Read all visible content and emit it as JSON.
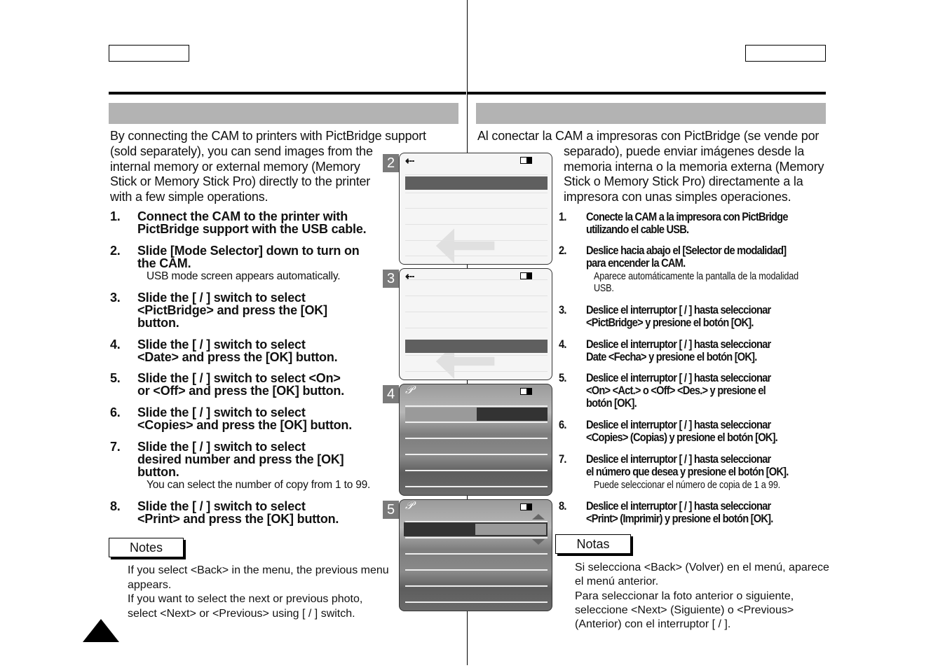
{
  "page": {
    "left_header_box": "",
    "right_header_box": ""
  },
  "en": {
    "intro": [
      "By connecting the CAM to printers with PictBridge support",
      "(sold separately), you can send images from the",
      "internal memory or external memory (Memory",
      "Stick or Memory Stick Pro) directly to the printer",
      "with a few simple operations."
    ],
    "steps": [
      {
        "num": "1.",
        "lines": [
          "Connect the CAM to the printer with",
          "PictBridge support with the USB cable."
        ]
      },
      {
        "num": "2.",
        "lines": [
          "Slide [Mode Selector] down to turn on",
          "the CAM."
        ],
        "note": [
          "USB mode screen appears automatically."
        ]
      },
      {
        "num": "3.",
        "lines": [
          "Slide the [     /     ] switch to select",
          "<PictBridge> and press the [OK]",
          "button."
        ]
      },
      {
        "num": "4.",
        "lines": [
          "Slide the [     /     ] switch to select",
          "<Date> and press the [OK] button."
        ]
      },
      {
        "num": "5.",
        "lines": [
          "Slide the [     /     ] switch to select <On>",
          "or <Off> and press the [OK] button."
        ]
      },
      {
        "num": "6.",
        "lines": [
          "Slide the [     /     ] switch to select",
          "<Copies> and press the [OK] button."
        ]
      },
      {
        "num": "7.",
        "lines": [
          "Slide the [     /     ] switch to select",
          "desired number and press the [OK]",
          "button."
        ],
        "note": [
          "You can select the number of copy from 1 to 99."
        ]
      },
      {
        "num": "8.",
        "lines": [
          "Slide the [     /     ] switch to select",
          "<Print> and press the [OK] button."
        ]
      }
    ],
    "notes_label": "Notes",
    "notes": [
      "If you select <Back> in the menu, the previous menu",
      "appears.",
      "If you want to select the next or previous photo,",
      "select <Next> or <Previous> using [     /     ] switch."
    ]
  },
  "es": {
    "intro": [
      "Al conectar la CAM a impresoras con PictBridge (se vende por",
      "separado), puede enviar imágenes desde la",
      "memoria interna o la memoria externa (Memory",
      "Stick o Memory Stick Pro) directamente a la",
      "impresora con unas simples operaciones."
    ],
    "steps": [
      {
        "num": "1.",
        "lines": [
          "Conecte la CAM a la impresora con PictBridge",
          "utilizando el cable USB."
        ]
      },
      {
        "num": "2.",
        "lines": [
          "Deslice hacia abajo el [Selector de modalidad]",
          "para encender la CAM."
        ],
        "note": [
          "Aparece automáticamente la pantalla de la modalidad",
          "USB."
        ]
      },
      {
        "num": "3.",
        "lines": [
          "Deslice el interruptor [     /     ] hasta seleccionar",
          "<PictBridge> y presione el botón [OK]."
        ]
      },
      {
        "num": "4.",
        "lines": [
          "Deslice el interruptor [     /     ] hasta seleccionar",
          "Date <Fecha> y presione el botón [OK]."
        ]
      },
      {
        "num": "5.",
        "lines": [
          "Deslice el interruptor [     /     ] hasta seleccionar",
          "<On> <Act.> o <Off> <Des.> y presione el",
          "botón [OK]."
        ]
      },
      {
        "num": "6.",
        "lines": [
          "Deslice el interruptor [     /     ] hasta seleccionar",
          "<Copies> (Copias) y presione el botón [OK]."
        ]
      },
      {
        "num": "7.",
        "lines": [
          "Deslice el interruptor [     /     ] hasta seleccionar",
          "el número que desea y presione el botón [OK]."
        ],
        "note": [
          "Puede seleccionar el número de copia de 1 a 99."
        ]
      },
      {
        "num": "8.",
        "lines": [
          "Deslice el interruptor [     /     ] hasta seleccionar",
          "<Print> (Imprimir) y presione el botón [OK]."
        ]
      }
    ],
    "notes_label": "Notas",
    "notes": [
      "Si selecciona <Back> (Volver) en el menú, aparece",
      "el menú anterior.",
      "Para seleccionar la foto anterior o siguiente,",
      "seleccione <Next> (Siguiente) o <Previous>",
      "(Anterior) con el interruptor [     /     ]."
    ]
  },
  "screens": [
    {
      "num": "2",
      "icon": "usb-icon",
      "highlight": "row-1"
    },
    {
      "num": "3",
      "icon": "usb-icon",
      "highlight": "row-4"
    },
    {
      "num": "4",
      "icon": "pictbridge-icon",
      "highlight": "row-1-right"
    },
    {
      "num": "5",
      "icon": "pictbridge-icon",
      "highlight": "row-1-left"
    }
  ],
  "colors": {
    "band": "#b3b3b3",
    "highlight": "#5f5f5f",
    "badge": "#7a7a7a"
  }
}
